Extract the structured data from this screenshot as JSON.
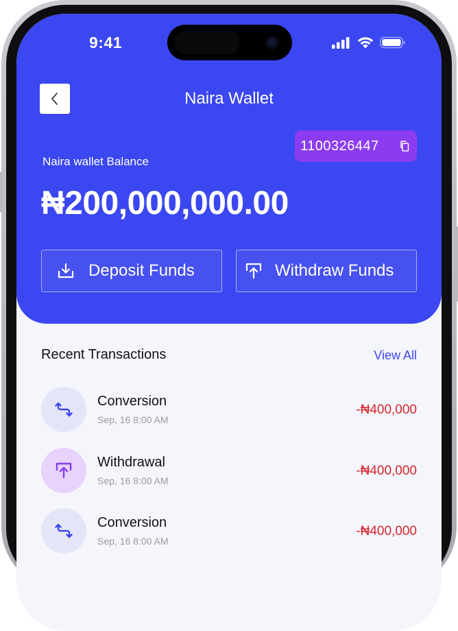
{
  "status_bar": {
    "time": "9:41"
  },
  "header": {
    "title": "Naira Wallet",
    "account_number": "1100326447",
    "balance_label": "Naira wallet Balance",
    "balance_amount": "₦200,000,000.00"
  },
  "actions": {
    "deposit_label": "Deposit Funds",
    "withdraw_label": "Withdraw Funds"
  },
  "transactions_section": {
    "title": "Recent Transactions",
    "view_all": "View All",
    "items": [
      {
        "type": "Conversion",
        "date": "Sep, 16 8:00 AM",
        "amount": "-₦400,000",
        "icon": "conversion-icon"
      },
      {
        "type": "Withdrawal",
        "date": "Sep, 16 8:00 AM",
        "amount": "-₦400,000",
        "icon": "withdraw-icon"
      },
      {
        "type": "Conversion",
        "date": "Sep, 16 8:00 AM",
        "amount": "-₦400,000",
        "icon": "conversion-icon"
      }
    ]
  },
  "colors": {
    "primary": "#3b47f0",
    "account_badge": "#8b3cf0",
    "negative_amount": "#d7252c",
    "conversion_bg": "#e4e6f7",
    "withdrawal_bg": "#e7d3fb"
  }
}
